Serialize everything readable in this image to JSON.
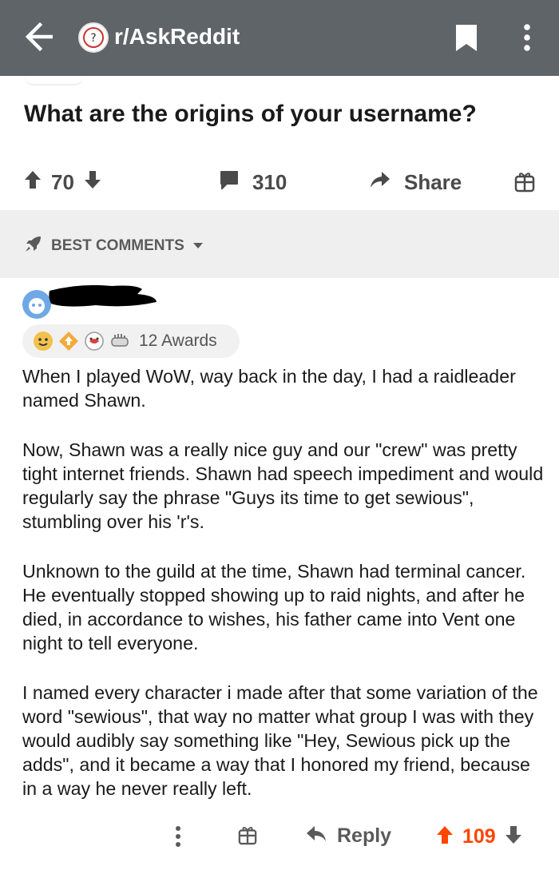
{
  "header": {
    "subreddit": "r/AskReddit"
  },
  "post": {
    "title": "What are the origins of your username?",
    "score": "70",
    "comments": "310",
    "share_label": "Share"
  },
  "sort": {
    "label": "BEST COMMENTS"
  },
  "comment": {
    "awards_label": "12 Awards",
    "paragraphs": [
      "When I played WoW, way back in the day, I had a raidleader named Shawn.",
      "Now, Shawn was a really nice guy and our \"crew\" was pretty tight internet friends. Shawn had speech impediment and would regularly say the phrase \"Guys its time to get sewious\", stumbling over his 'r's.",
      "Unknown to the guild at the time, Shawn had terminal cancer. He eventually stopped showing up to raid nights, and after he died, in accordance to wishes, his father came into Vent one night to tell everyone.",
      "I named every character i made after that some variation of the word \"sewious\", that way no matter what group I was with they would audibly say something like \"Hey, Sewious pick up the adds\", and it became a way that I honored my friend, because in a way he never really left."
    ],
    "reply_label": "Reply",
    "score": "109"
  },
  "colors": {
    "topbar": "#5f6468",
    "upvote": "#ff4500",
    "sortbar": "#efefef"
  }
}
